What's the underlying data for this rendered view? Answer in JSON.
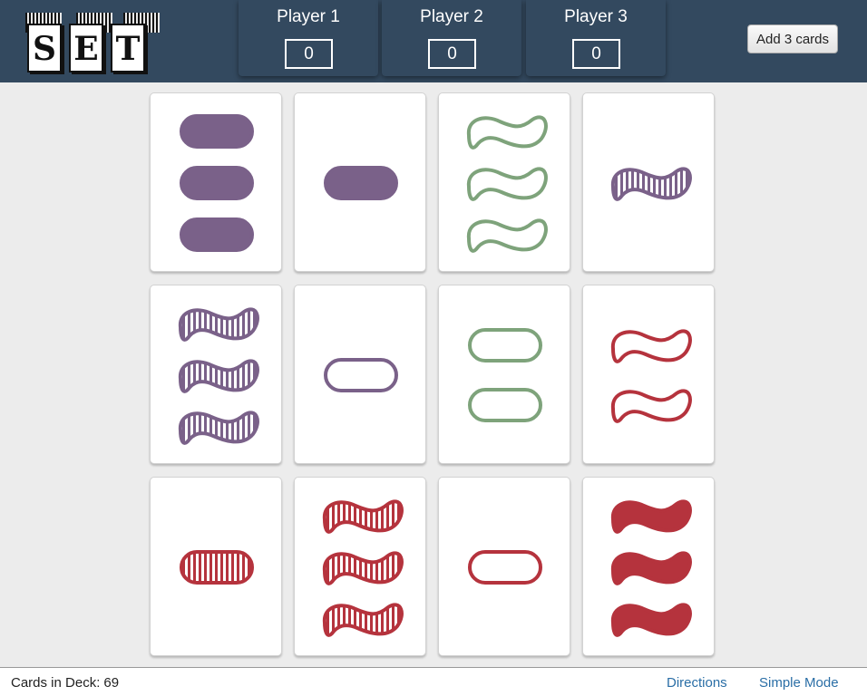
{
  "logo": {
    "letters": [
      "S",
      "E",
      "T"
    ]
  },
  "players": [
    {
      "name": "Player 1",
      "score": "0"
    },
    {
      "name": "Player 2",
      "score": "0"
    },
    {
      "name": "Player 3",
      "score": "0"
    }
  ],
  "toolbar": {
    "add_cards_label": "Add 3 cards"
  },
  "colors": {
    "purple": "#7a6189",
    "green": "#7ea37b",
    "red": "#b5333d",
    "header": "#33495f"
  },
  "cards": [
    {
      "count": 3,
      "shape": "oval",
      "fill": "solid",
      "color": "purple"
    },
    {
      "count": 1,
      "shape": "oval",
      "fill": "solid",
      "color": "purple"
    },
    {
      "count": 3,
      "shape": "squiggle",
      "fill": "empty",
      "color": "green"
    },
    {
      "count": 1,
      "shape": "squiggle",
      "fill": "striped",
      "color": "purple"
    },
    {
      "count": 3,
      "shape": "squiggle",
      "fill": "striped",
      "color": "purple"
    },
    {
      "count": 1,
      "shape": "oval",
      "fill": "empty",
      "color": "purple"
    },
    {
      "count": 2,
      "shape": "oval",
      "fill": "empty",
      "color": "green"
    },
    {
      "count": 2,
      "shape": "squiggle",
      "fill": "empty",
      "color": "red"
    },
    {
      "count": 1,
      "shape": "oval",
      "fill": "striped",
      "color": "red"
    },
    {
      "count": 3,
      "shape": "squiggle",
      "fill": "striped",
      "color": "red"
    },
    {
      "count": 1,
      "shape": "oval",
      "fill": "empty",
      "color": "red"
    },
    {
      "count": 3,
      "shape": "squiggle",
      "fill": "solid",
      "color": "red"
    }
  ],
  "footer": {
    "deck_label": "Cards in Deck:",
    "deck_count": "69",
    "directions_link": "Directions",
    "simple_mode_link": "Simple Mode"
  }
}
